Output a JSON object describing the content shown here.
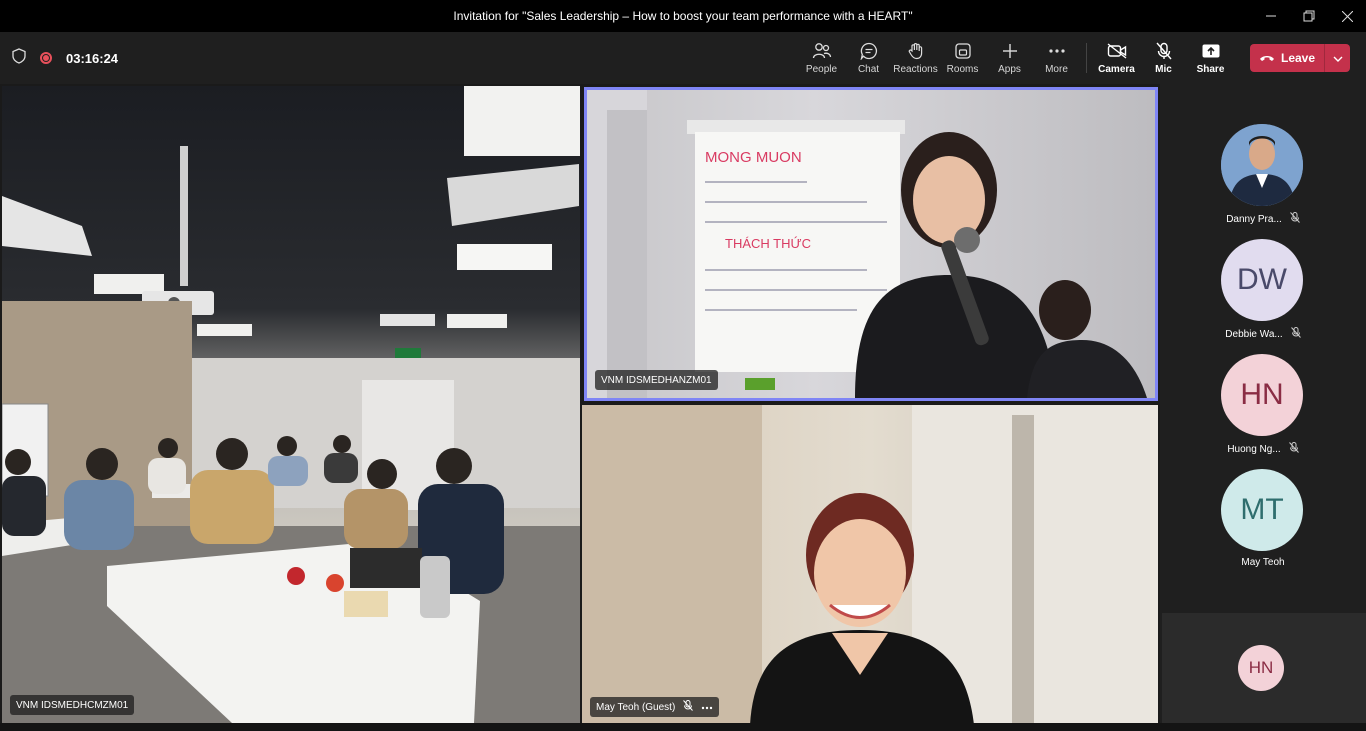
{
  "window": {
    "title": "Invitation for \"Sales Leadership – How to boost your team performance with a HEART\""
  },
  "toolbar": {
    "timer": "03:16:24",
    "tools": [
      {
        "label": "People",
        "icon": "people-icon"
      },
      {
        "label": "Chat",
        "icon": "chat-icon"
      },
      {
        "label": "Reactions",
        "icon": "hand-icon"
      },
      {
        "label": "Rooms",
        "icon": "rooms-icon"
      },
      {
        "label": "Apps",
        "icon": "plus-icon"
      },
      {
        "label": "More",
        "icon": "more-icon"
      }
    ],
    "media": [
      {
        "label": "Camera",
        "icon": "camera-off-icon"
      },
      {
        "label": "Mic",
        "icon": "mic-off-icon"
      },
      {
        "label": "Share",
        "icon": "share-icon"
      }
    ],
    "leave_label": "Leave"
  },
  "tiles": [
    {
      "name": "VNM IDSMEDHCMZM01"
    },
    {
      "name": "VNM IDSMEDHANZM01"
    },
    {
      "name": "May Teoh (Guest)"
    }
  ],
  "whiteboard": {
    "heading": "MONG MUON",
    "subheading": "THÁCH THỨC"
  },
  "participants": [
    {
      "name": "Danny Pra...",
      "initials": "",
      "muted": true,
      "bg": "#5a7fa8",
      "fg": "#ffffff"
    },
    {
      "name": "Debbie Wa...",
      "initials": "DW",
      "muted": true,
      "bg": "#e1dcef",
      "fg": "#4a4a6a"
    },
    {
      "name": "Huong Ng...",
      "initials": "HN",
      "muted": true,
      "bg": "#f3d2d8",
      "fg": "#8a2c44"
    },
    {
      "name": "May Teoh",
      "initials": "MT",
      "muted": false,
      "bg": "#cfeaea",
      "fg": "#2f6e6e"
    }
  ],
  "self_view": {
    "initials": "HN"
  },
  "colors": {
    "leave": "#c4314b",
    "active_speaker": "#7f85f5",
    "recording": "#e8505b"
  }
}
